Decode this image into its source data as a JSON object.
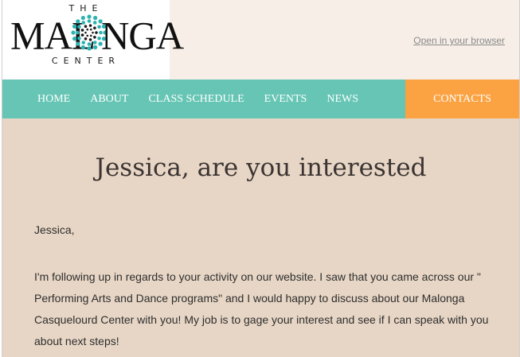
{
  "logo": {
    "the": "THE",
    "left_word": "MAL",
    "right_word": "NGA",
    "center_word": "CENTER",
    "accent_color": "#2bb3b1"
  },
  "header": {
    "browser_link": "Open in your browser"
  },
  "nav": {
    "items": [
      {
        "label": "HOME"
      },
      {
        "label": "ABOUT"
      },
      {
        "label": "CLASS SCHEDULE"
      },
      {
        "label": "EVENTS"
      },
      {
        "label": "NEWS"
      }
    ],
    "contacts": "CONTACTS",
    "colors": {
      "bar": "#66c5b4",
      "contacts": "#fba342"
    }
  },
  "main": {
    "headline": "Jessica, are you interested",
    "greeting": "Jessica,",
    "body": "I'm following up in regards to your activity on our website. I saw that you came across our \" Performing Arts and Dance programs\" and I would happy to discuss about our Malonga Casquelourd Center with you! My job is to gage your interest and see if I can speak with you about next steps!",
    "background": "#e7d6c5"
  }
}
